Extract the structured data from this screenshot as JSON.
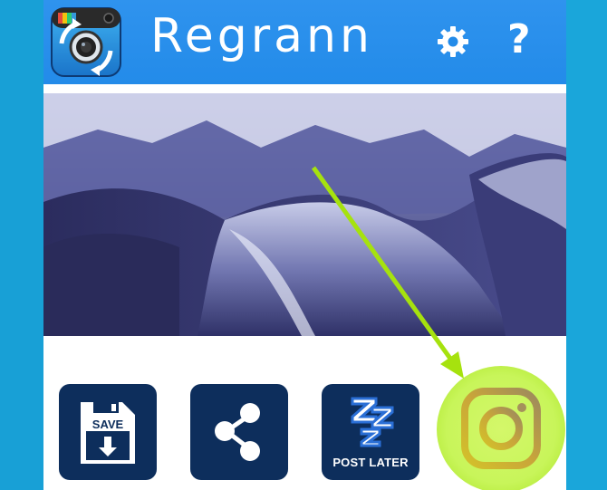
{
  "app": {
    "title": "Regrann"
  },
  "header": {
    "settings_icon": "gear-icon",
    "help_label": "?"
  },
  "photo": {
    "description_icon": "snow-landscape-image"
  },
  "actions": {
    "save_label": "SAVE",
    "share_icon": "share-icon",
    "post_later_label": "POST LATER",
    "post_later_icon": "zzz-icon",
    "instagram_icon": "instagram-icon"
  },
  "colors": {
    "header_blue": "#238be9",
    "tile_navy": "#0d2e5c",
    "highlight_green": "#c8f55a",
    "arrow_green": "#a6e20e",
    "side_blue": "#1aa3d6"
  }
}
